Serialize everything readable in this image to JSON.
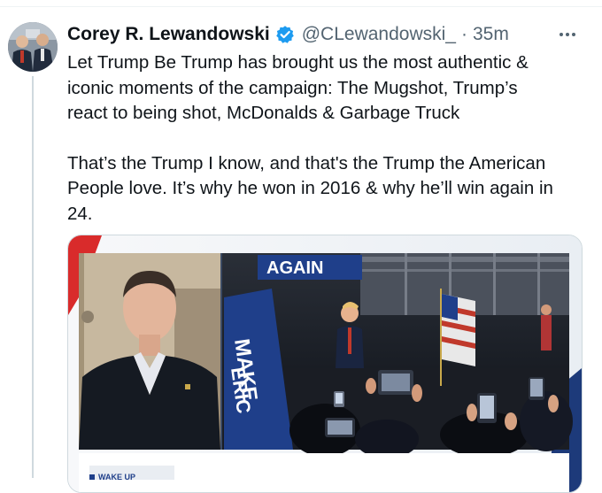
{
  "tweet": {
    "author_name": "Corey R. Lewandowski",
    "handle": "@CLewandowski_",
    "separator": "·",
    "time": "35m",
    "verified_icon": "verified-badge-icon",
    "more_icon": "more-options-icon",
    "paragraph_1": "Let Trump Be Trump has brought us the most authentic &\niconic moments of the campaign: The Mugshot, Trump’s\nreact to being shot, McDonalds & Garbage Truck",
    "paragraph_2": "That’s the Trump I know, and that's the Trump the American\nPeople love. It’s why he won in 2016 & why he’ll win again in\n24."
  },
  "media": {
    "banner_text": "AGAIN",
    "sign_text_1": "MAKE",
    "sign_text_2": "ERIC",
    "ticker_text": "WAKE UP"
  },
  "colors": {
    "verified_blue": "#1d9bf0",
    "text": "#0f1419",
    "secondary": "#536471"
  }
}
